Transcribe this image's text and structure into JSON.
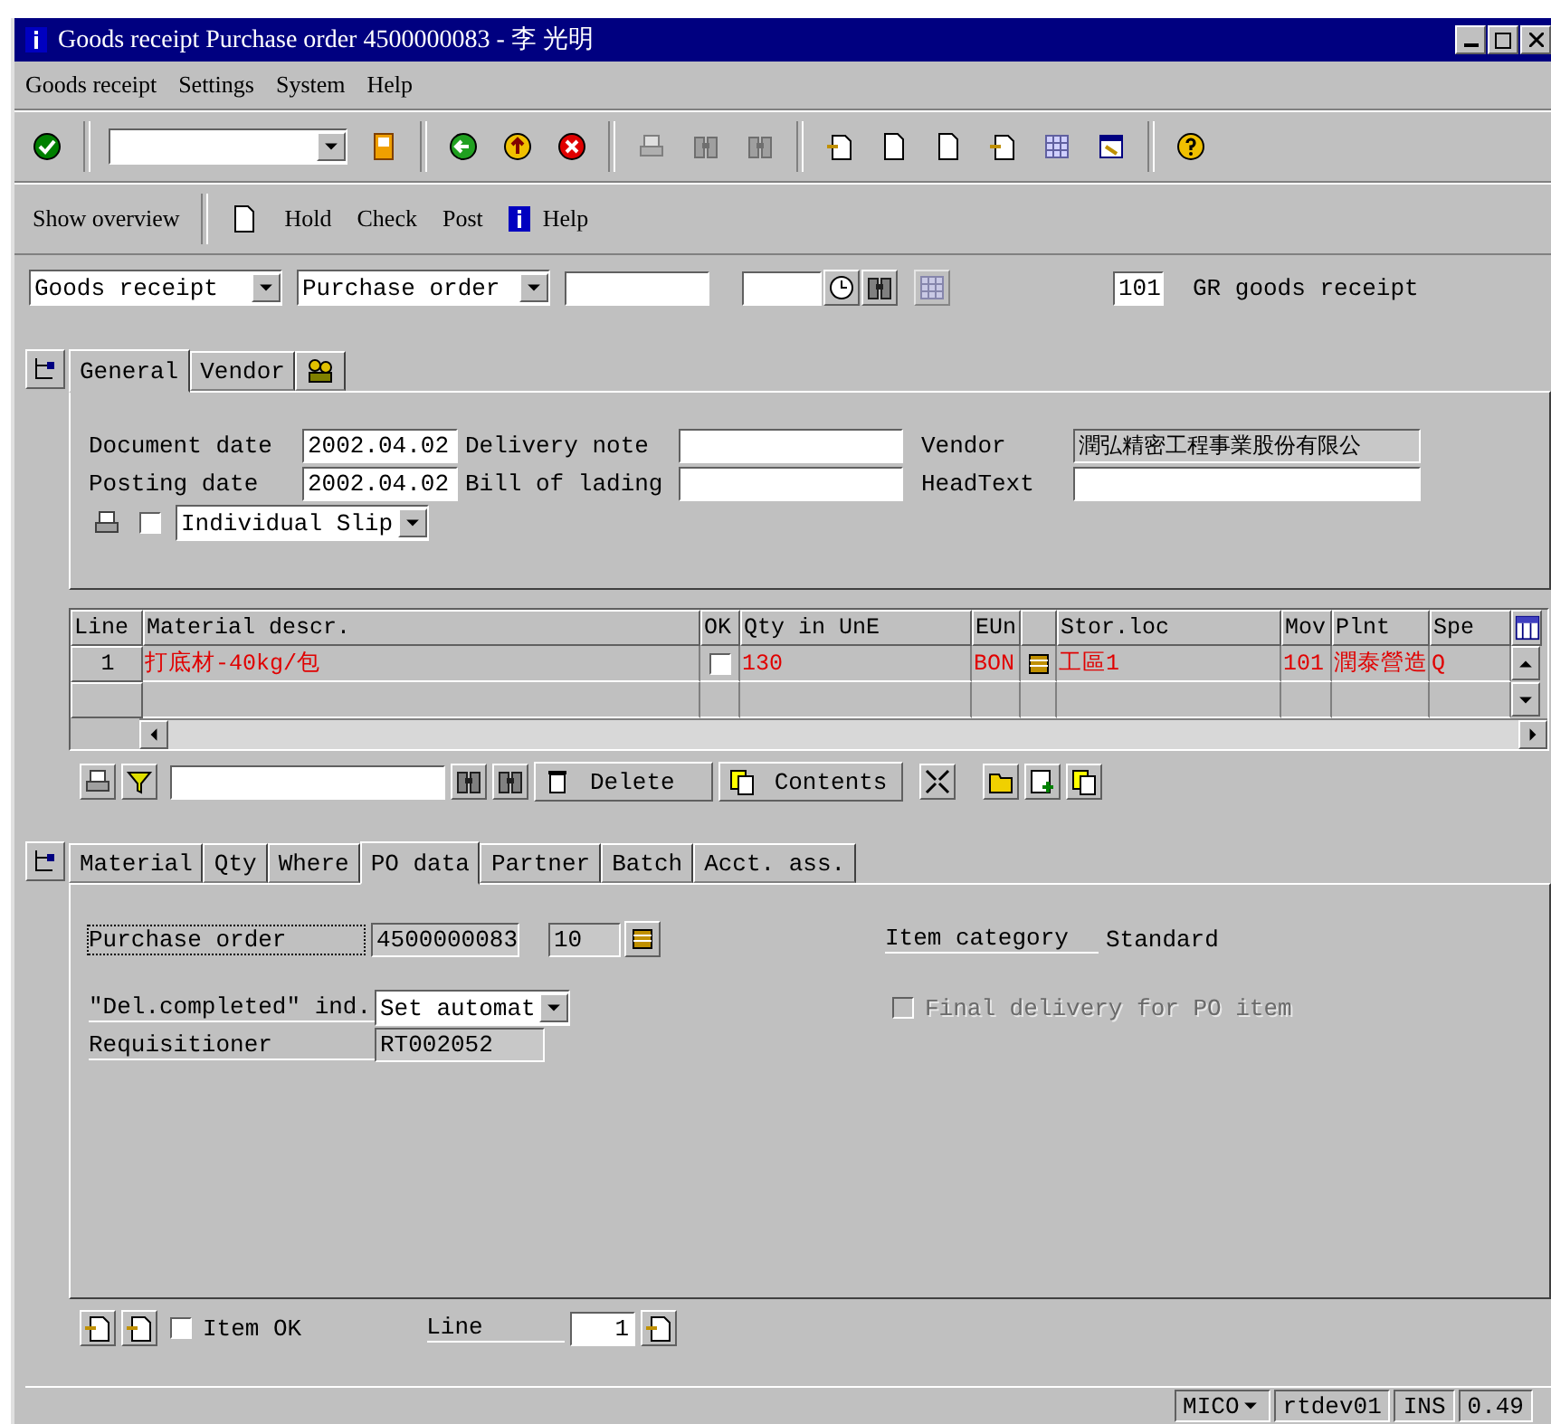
{
  "window": {
    "title": "Goods receipt Purchase order 4500000083 - 李 光明"
  },
  "menu": [
    "Goods receipt",
    "Settings",
    "System",
    "Help"
  ],
  "app_toolbar": {
    "overview": "Show overview",
    "actions": [
      "Hold",
      "Check",
      "Post"
    ],
    "help": "Help"
  },
  "header": {
    "action": "Goods receipt",
    "reference": "Purchase order",
    "movement_type": "101",
    "movement_text": "GR goods receipt"
  },
  "header_tabs": [
    {
      "label": "General",
      "selected": true
    },
    {
      "label": "Vendor",
      "selected": false
    }
  ],
  "general_rows": [
    [
      {
        "label": "Document date",
        "value": "2002.04.02",
        "editable": true
      },
      {
        "label": "Delivery note",
        "editable": true
      },
      {
        "label": "Vendor",
        "value": "潤弘精密工程事業股份有限公",
        "editable": false
      }
    ],
    [
      {
        "label": "Posting date",
        "value": "2002.04.02",
        "editable": true
      },
      {
        "label": "Bill of lading",
        "editable": true
      },
      {
        "label": "HeadText",
        "editable": true
      }
    ]
  ],
  "print": {
    "checked": false,
    "slip": "Individual Slip"
  },
  "items_table": {
    "columns": [
      "Line",
      "Material descr.",
      "OK",
      "Qty in UnE",
      "EUn",
      "Stor.loc",
      "Mov",
      "Plnt",
      "Spe"
    ],
    "rows": [
      {
        "line": "1",
        "material": "打底材-40kg/包",
        "ok": false,
        "qty": "130",
        "unit": "BON",
        "stor_loc": "工區1",
        "mov": "101",
        "plant": "潤泰營造",
        "spe": "Q"
      }
    ]
  },
  "table_toolbar": {
    "delete": "Delete",
    "contents": "Contents"
  },
  "item_tabs": [
    {
      "label": "Material",
      "selected": false
    },
    {
      "label": "Qty",
      "selected": false
    },
    {
      "label": "Where",
      "selected": false
    },
    {
      "label": "PO data",
      "selected": true
    },
    {
      "label": "Partner",
      "selected": false
    },
    {
      "label": "Batch",
      "selected": false
    },
    {
      "label": "Acct. ass.",
      "selected": false
    }
  ],
  "po_data": {
    "purchase_order_label": "Purchase order",
    "purchase_order": "4500000083",
    "item": "10",
    "item_category_label": "Item category",
    "item_category": "Standard",
    "del_completed_label": "\"Del.completed\" ind.",
    "del_completed": "Set automat",
    "requisitioner_label": "Requisitioner",
    "requisitioner": "RT002052",
    "final_delivery": {
      "label": "Final delivery for PO item",
      "checked": false,
      "disabled": true
    }
  },
  "footer": {
    "item_ok": {
      "label": "Item OK",
      "checked": false
    },
    "line_label": "Line",
    "line": "1"
  },
  "status_bar": [
    "MICO",
    "rtdev01",
    "INS",
    "0.49"
  ]
}
